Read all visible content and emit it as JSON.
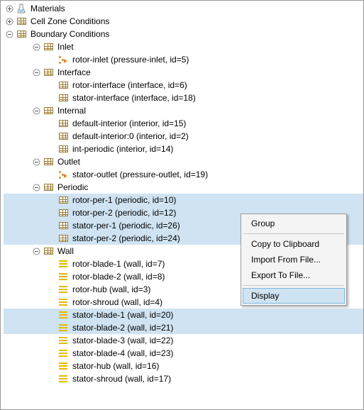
{
  "tree": {
    "materials": "Materials",
    "cell_zone": "Cell Zone Conditions",
    "boundary": "Boundary Conditions",
    "inlet": {
      "label": "Inlet",
      "items": [
        "rotor-inlet (pressure-inlet, id=5)"
      ]
    },
    "interface": {
      "label": "Interface",
      "items": [
        "rotor-interface (interface, id=6)",
        "stator-interface (interface, id=18)"
      ]
    },
    "internal": {
      "label": "Internal",
      "items": [
        "default-interior (interior, id=15)",
        "default-interior:0 (interior, id=2)",
        "int-periodic (interior, id=14)"
      ]
    },
    "outlet": {
      "label": "Outlet",
      "items": [
        "stator-outlet (pressure-outlet, id=19)"
      ]
    },
    "periodic": {
      "label": "Periodic",
      "items": [
        "rotor-per-1 (periodic, id=10)",
        "rotor-per-2 (periodic, id=12)",
        "stator-per-1 (periodic, id=26)",
        "stator-per-2 (periodic, id=24)"
      ]
    },
    "wall": {
      "label": "Wall",
      "items": [
        "rotor-blade-1 (wall, id=7)",
        "rotor-blade-2 (wall, id=8)",
        "rotor-hub (wall, id=3)",
        "rotor-shroud (wall, id=4)",
        "stator-blade-1 (wall, id=20)",
        "stator-blade-2 (wall, id=21)",
        "stator-blade-3 (wall, id=22)",
        "stator-blade-4 (wall, id=23)",
        "stator-hub (wall, id=16)",
        "stator-shroud (wall, id=17)"
      ]
    }
  },
  "wall_selected": [
    false,
    false,
    false,
    false,
    true,
    true,
    false,
    false,
    false,
    false
  ],
  "context_menu": {
    "group": "Group",
    "copy": "Copy to Clipboard",
    "import": "Import From File...",
    "export": "Export To File...",
    "display": "Display"
  }
}
